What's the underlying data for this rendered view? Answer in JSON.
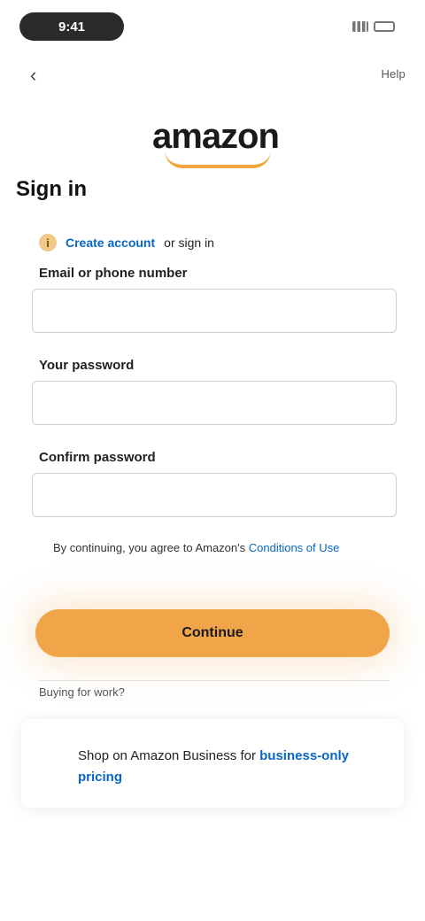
{
  "status_bar": {
    "time": "9:41"
  },
  "nav": {
    "back_icon": "chevron-left-icon",
    "help": "Help"
  },
  "logo": {
    "text": "amazon"
  },
  "page": {
    "title": "Sign in"
  },
  "login_hint": {
    "icon": "info-icon",
    "link_text": "Create account",
    "rest_text": "or sign in"
  },
  "fields": [
    {
      "label": "Email or phone number",
      "value": "",
      "placeholder": ""
    },
    {
      "label": "Your password",
      "value": "",
      "placeholder": ""
    },
    {
      "label": "Confirm password",
      "value": "",
      "placeholder": ""
    }
  ],
  "terms": {
    "text": "By continuing, you agree to Amazon's",
    "link": "Conditions of Use"
  },
  "primary_button": {
    "label": "Continue"
  },
  "divider": {
    "text": "Buying for work?"
  },
  "business": {
    "text": "Shop on Amazon Business for",
    "link": "business-only pricing"
  },
  "colors": {
    "accent": "#f0a548",
    "link": "#0a66c2",
    "background": "#ffffff"
  }
}
